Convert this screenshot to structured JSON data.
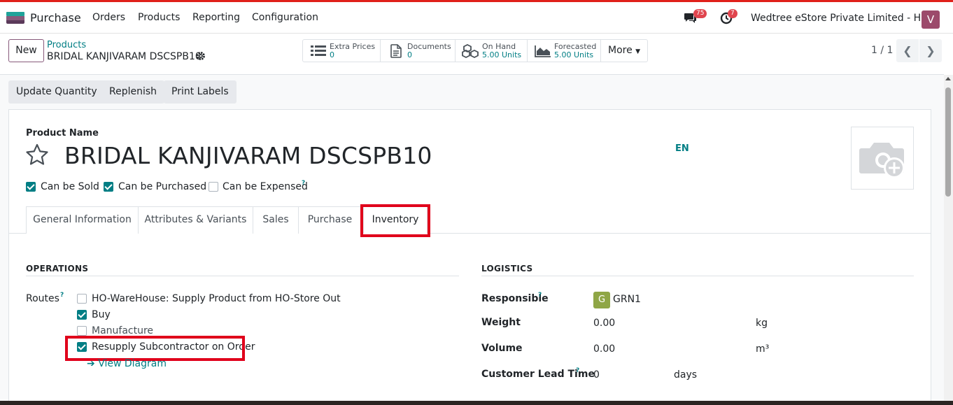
{
  "nav": {
    "app_name": "Purchase",
    "menu": [
      "Orders",
      "Products",
      "Reporting",
      "Configuration"
    ],
    "messages_count": "75",
    "activities_count": "7",
    "company": "Wedtree eStore Private Limited - HO",
    "user_initial": "V"
  },
  "control": {
    "new_label": "New",
    "breadcrumb_parent": "Products",
    "breadcrumb_current": "BRIDAL KANJIVARAM DSCSPB10",
    "smart_buttons": [
      {
        "label": "Extra Prices",
        "value": "0",
        "icon": "list-icon"
      },
      {
        "label": "Documents",
        "value": "0",
        "icon": "document-icon"
      },
      {
        "label": "On Hand",
        "value": "5.00 Units",
        "icon": "cubes-icon"
      },
      {
        "label": "Forecasted",
        "value": "5.00 Units",
        "icon": "area-chart-icon"
      }
    ],
    "more_label": "More",
    "pager": "1 / 1"
  },
  "actions": [
    "Update Quantity",
    "Replenish",
    "Print Labels"
  ],
  "form": {
    "product_name_label": "Product Name",
    "product_name": "BRIDAL KANJIVARAM DSCSPB10",
    "lang": "EN",
    "flags": [
      {
        "label": "Can be Sold",
        "checked": true
      },
      {
        "label": "Can be Purchased",
        "checked": true
      },
      {
        "label": "Can be Expensed",
        "checked": false
      }
    ],
    "help_mark": "?",
    "tabs": [
      "General Information",
      "Attributes & Variants",
      "Sales",
      "Purchase",
      "Inventory"
    ],
    "active_tab": "Inventory"
  },
  "operations": {
    "title": "OPERATIONS",
    "routes_label": "Routes",
    "routes": [
      {
        "label": "HO-WareHouse: Supply Product from HO-Store Out",
        "checked": false
      },
      {
        "label": "Buy",
        "checked": true
      },
      {
        "label": "Manufacture",
        "checked": false
      },
      {
        "label": "Resupply Subcontractor on Order",
        "checked": true
      }
    ],
    "view_diagram": "View Diagram"
  },
  "logistics": {
    "title": "LOGISTICS",
    "responsible_label": "Responsible",
    "responsible_initial": "G",
    "responsible_value": "GRN1",
    "weight_label": "Weight",
    "weight_value": "0.00",
    "weight_unit": "kg",
    "volume_label": "Volume",
    "volume_value": "0.00",
    "volume_unit": "m³",
    "lead_time_label": "Customer Lead Time",
    "lead_time_value": "0",
    "lead_time_unit": "days"
  },
  "colors": {
    "accent": "#017e84",
    "brand": "#875a7b",
    "highlight": "#e0001b"
  }
}
